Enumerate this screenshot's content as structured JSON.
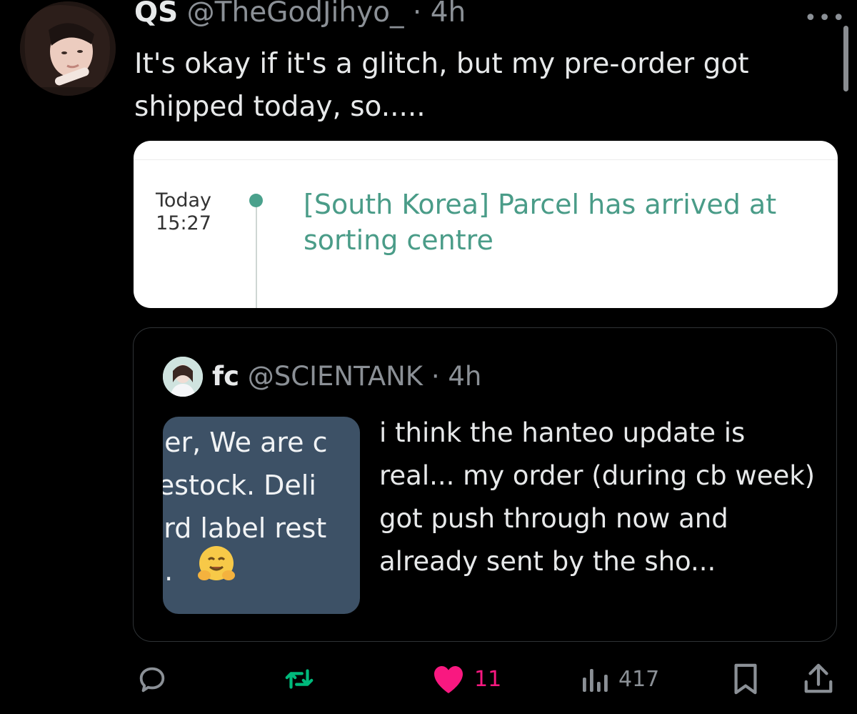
{
  "tweet": {
    "author_name": "QS",
    "handle_time": "@TheGodJihyo_ · 4h",
    "more_label": "•••",
    "text": "It's okay if it's a glitch, but my pre-order got shipped today, so....."
  },
  "tracking_card": {
    "date": "Today",
    "time": "15:27",
    "message": "[South Korea] Parcel has arrived at sorting centre",
    "accent_color": "#4a9c88"
  },
  "quoted_tweet": {
    "author_name": "fc",
    "handle_time": "@SCIENTANK · 4h",
    "image_text_lines": [
      "der, We are c",
      "restock. Deli",
      "ord label rest",
      "g."
    ],
    "text": "i think the hanteo update is real... my order (during cb week) got push through now and already sent by the sho..."
  },
  "actions": {
    "reply_icon": "reply-icon",
    "retweet_icon": "retweet-icon",
    "like_icon": "heart-icon",
    "like_count": "11",
    "views_icon": "views-icon",
    "views_count": "417",
    "bookmark_icon": "bookmark-icon",
    "share_icon": "share-icon",
    "retweet_color": "#00ba7c",
    "like_color": "#f91880"
  }
}
